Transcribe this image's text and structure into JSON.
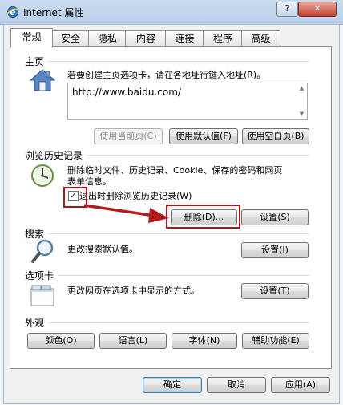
{
  "window": {
    "title": "Internet 属性",
    "help": "?",
    "close": "✕"
  },
  "tabs": [
    {
      "label": "常规",
      "active": true
    },
    {
      "label": "安全"
    },
    {
      "label": "隐私"
    },
    {
      "label": "内容"
    },
    {
      "label": "连接"
    },
    {
      "label": "程序"
    },
    {
      "label": "高级"
    }
  ],
  "home": {
    "section": "主页",
    "desc": "若要创建主页选项卡，请在各地址行键入地址(R)。",
    "url": "http://www.baidu.com/",
    "btn_current": "使用当前页(C)",
    "btn_default": "使用默认值(F)",
    "btn_blank": "使用空白页(B)"
  },
  "history": {
    "section": "浏览历史记录",
    "desc_line1": "删除临时文件、历史记录、Cookie、保存的密码和网页",
    "desc_line2": "表单信息。",
    "checkbox_checked": "✓",
    "checkbox_label": "退出时删除浏览历史记录(W)",
    "btn_delete": "删除(D)...",
    "btn_settings": "设置(S)"
  },
  "search": {
    "section": "搜索",
    "desc": "更改搜索默认值。",
    "btn_settings": "设置(I)"
  },
  "tabs_section": {
    "section": "选项卡",
    "desc": "更改网页在选项卡中显示的方式。",
    "btn_settings": "设置(T)"
  },
  "appearance": {
    "section": "外观",
    "btn_colors": "颜色(O)",
    "btn_languages": "语言(L)",
    "btn_fonts": "字体(N)",
    "btn_accessibility": "辅助功能(E)"
  },
  "footer": {
    "ok": "确定",
    "cancel": "取消",
    "apply": "应用(A)"
  },
  "colors": {
    "highlight_red": "#a8141a",
    "arrow_red": "#b01c1c"
  }
}
